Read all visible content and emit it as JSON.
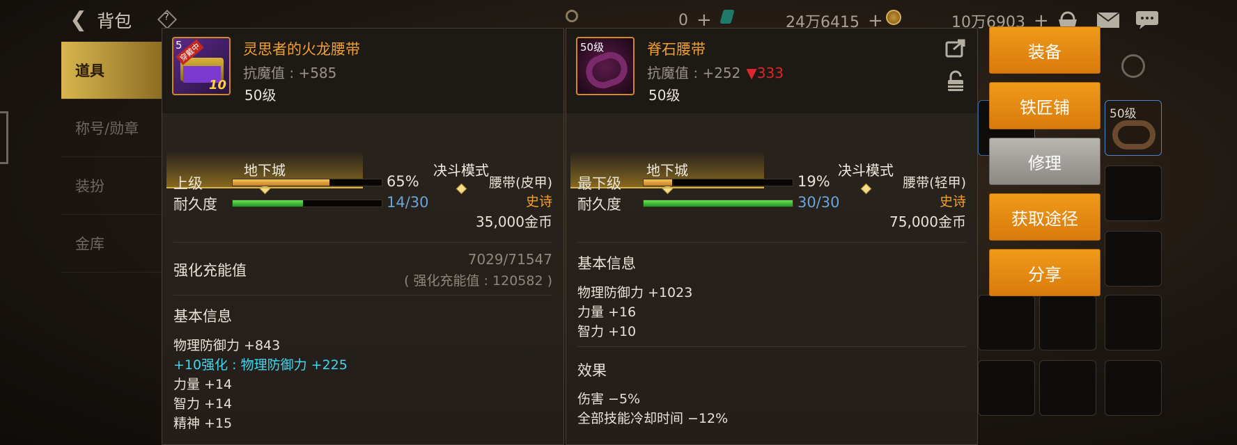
{
  "topbar": {
    "title": "背包",
    "help": "?",
    "currency1": "0",
    "currency2": "24万6415",
    "currency3": "10万6903"
  },
  "leftnav": {
    "items": [
      "道具",
      "称号/勋章",
      "装扮",
      "金库"
    ]
  },
  "left_item": {
    "name": "灵思者的火龙腰带",
    "level_badge": "5",
    "tag": "穿戴中",
    "enhance_badge": "10",
    "resist_label": "抗魔值 : +585",
    "level": "50级",
    "tabs": [
      "地下城",
      "决斗模式"
    ],
    "grade_label": "上级",
    "grade_value": "65%",
    "grade_pct": 65,
    "durability_label": "耐久度",
    "durability_value": "14/30",
    "durability_pct": 47,
    "item_type": "腰带(皮甲)",
    "rarity": "史诗",
    "price": "35,000金币",
    "enhance_title": "强化充能值",
    "enhance_value": "7029/71547",
    "enhance_sub": "( 强化充能值 : 120582 )",
    "basic_title": "基本信息",
    "lines": [
      "物理防御力 +843",
      "+10强化 : 物理防御力 +225",
      "力量 +14",
      "智力 +14",
      "精神 +15"
    ]
  },
  "right_item": {
    "name": "脊石腰带",
    "level_badge": "50级",
    "resist_label": "抗魔值 : +252",
    "resist_diff": "▼333",
    "level": "50级",
    "tabs": [
      "地下城",
      "决斗模式"
    ],
    "grade_label": "最下级",
    "grade_value": "19%",
    "grade_pct": 19,
    "durability_label": "耐久度",
    "durability_value": "30/30",
    "durability_pct": 100,
    "item_type": "腰带(轻甲)",
    "rarity": "史诗",
    "price": "75,000金币",
    "basic_title": "基本信息",
    "lines": [
      "物理防御力 +1023",
      "力量 +16",
      "智力 +10"
    ],
    "effect_title": "效果",
    "effects": [
      "伤害 −5%",
      "全部技能冷却时间 −12%"
    ]
  },
  "actions": [
    "装备",
    "铁匠铺",
    "修理",
    "获取途径",
    "分享"
  ],
  "inventory": {
    "slot_label": "50级"
  },
  "colors": {
    "gold": "#d8b24a",
    "orange": "#f0a030",
    "cyan": "#3fd7f0",
    "red": "#e0262a",
    "durability_green": "#2ec12a",
    "grade_orange": "#e8a33a"
  }
}
